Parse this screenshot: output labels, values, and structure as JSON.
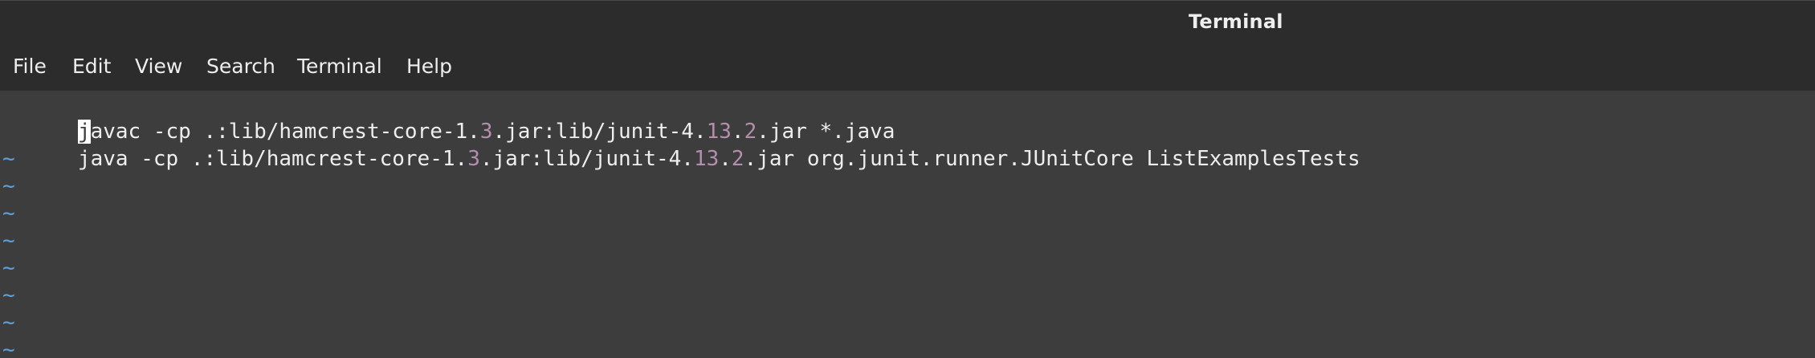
{
  "window": {
    "title": "Terminal"
  },
  "menu": {
    "items": [
      "File",
      "Edit",
      "View",
      "Search",
      "Terminal",
      "Help"
    ]
  },
  "editor": {
    "lines": [
      {
        "segments": [
          {
            "text": "j",
            "style": "cursor"
          },
          {
            "text": "avac -cp .:lib/hamcrest-core-1.",
            "style": "normal"
          },
          {
            "text": "3",
            "style": "num"
          },
          {
            "text": ".jar:lib/junit-4.",
            "style": "normal"
          },
          {
            "text": "13",
            "style": "num"
          },
          {
            "text": ".",
            "style": "normal"
          },
          {
            "text": "2",
            "style": "num"
          },
          {
            "text": ".jar *.java",
            "style": "normal"
          }
        ]
      },
      {
        "segments": [
          {
            "text": "java -cp .:lib/hamcrest-core-1.",
            "style": "normal"
          },
          {
            "text": "3",
            "style": "num"
          },
          {
            "text": ".jar:lib/junit-4.",
            "style": "normal"
          },
          {
            "text": "13",
            "style": "num"
          },
          {
            "text": ".",
            "style": "normal"
          },
          {
            "text": "2",
            "style": "num"
          },
          {
            "text": ".jar org.junit.runner.JUnitCore ListExamplesTests",
            "style": "normal"
          }
        ]
      }
    ],
    "empty_line_marker": "~"
  },
  "colors": {
    "background": "#3d3d3d",
    "chrome": "#2c2c2c",
    "text": "#eeeeee",
    "number": "#b48ead",
    "tilde": "#5fa0d8"
  }
}
